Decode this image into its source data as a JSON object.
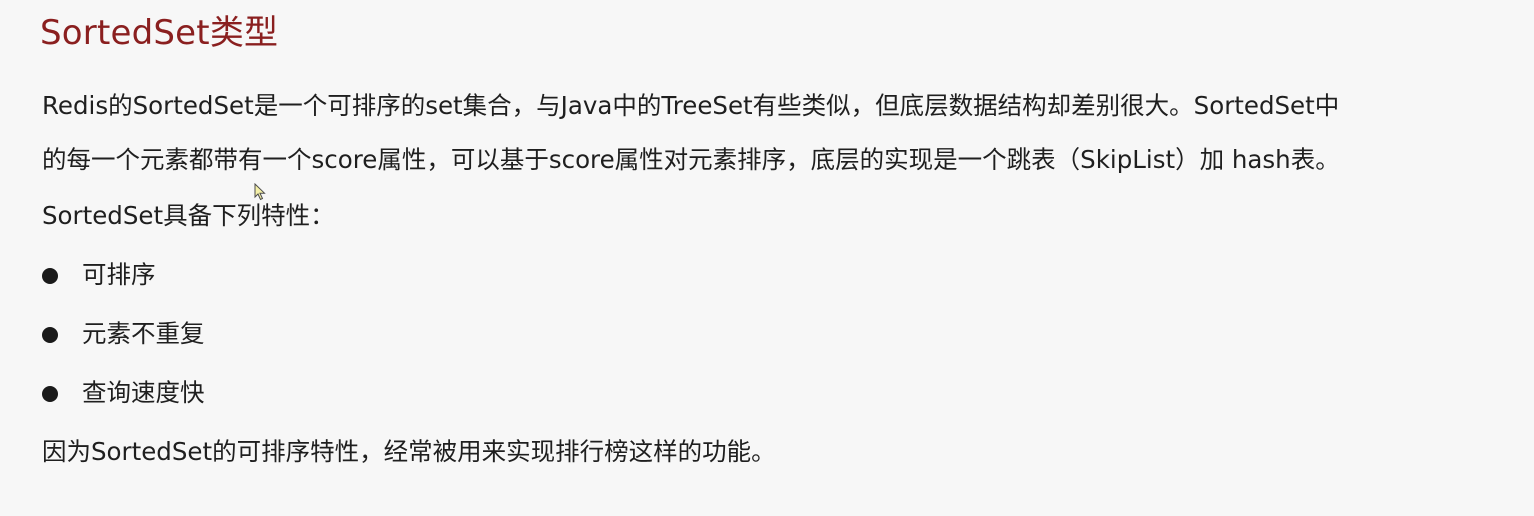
{
  "title": "SortedSet类型",
  "paragraphs": {
    "intro_line1": "Redis的SortedSet是一个可排序的set集合，与Java中的TreeSet有些类似，但底层数据结构却差别很大。SortedSet中",
    "intro_line2": "的每一个元素都带有一个score属性，可以基于score属性对元素排序，底层的实现是一个跳表（SkipList）加 hash表。",
    "features_intro": "SortedSet具备下列特性：",
    "conclusion": "因为SortedSet的可排序特性，经常被用来实现排行榜这样的功能。"
  },
  "features": [
    {
      "label": "可排序"
    },
    {
      "label": "元素不重复"
    },
    {
      "label": "查询速度快"
    }
  ],
  "colors": {
    "title": "#8a1f1f",
    "text": "#1f1f1f",
    "background": "#f7f7f7"
  }
}
